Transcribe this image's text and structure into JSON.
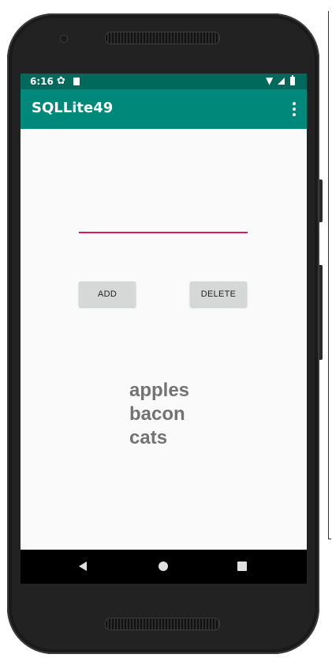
{
  "statusbar": {
    "time": "6:16"
  },
  "appbar": {
    "title": "SQLLite49"
  },
  "form": {
    "input_value": "",
    "add_label": "ADD",
    "delete_label": "DELETE"
  },
  "list": {
    "items": [
      "apples",
      "bacon",
      "",
      "cats"
    ]
  },
  "colors": {
    "status_bar": "#00695c",
    "app_bar": "#00897b",
    "accent": "#d81b60",
    "button": "#d6d7d7",
    "list_text": "#737373"
  },
  "icons": {
    "status": [
      "gear-icon",
      "sd-card-icon",
      "wifi-icon",
      "signal-icon",
      "battery-icon"
    ],
    "fab": "email-icon",
    "nav": [
      "back-icon",
      "home-icon",
      "recents-icon"
    ]
  }
}
